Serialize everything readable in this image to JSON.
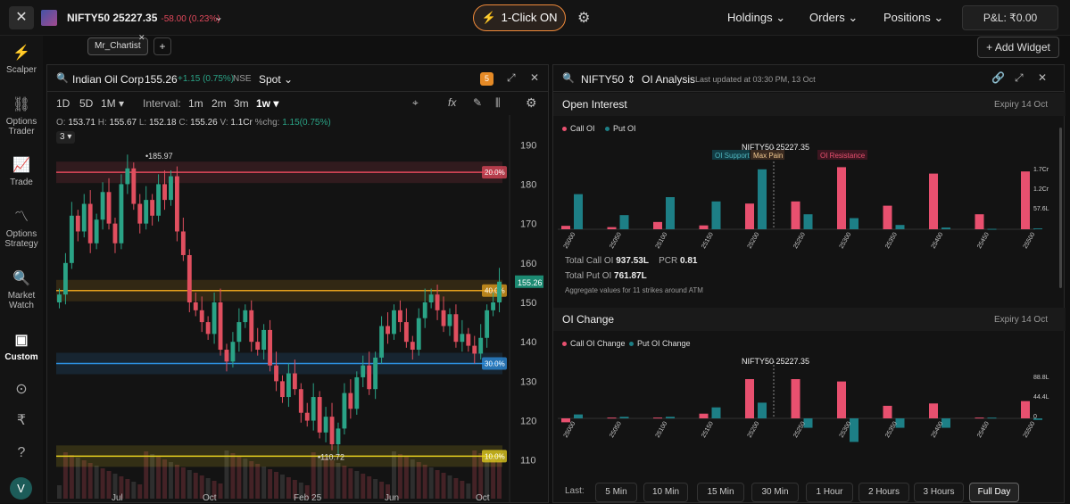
{
  "header": {
    "symbol": "NIFTY50 25227.35",
    "change": "-58.00 (0.23%)",
    "one_click": "1-Click ON",
    "nav": [
      "Holdings",
      "Orders",
      "Positions"
    ],
    "pnl": "P&L: ₹0.00"
  },
  "sidebar": {
    "items": [
      {
        "label": "Scalper",
        "icon": "lightning-icon"
      },
      {
        "label": "Options Trader",
        "icon": "link-icon"
      },
      {
        "label": "Trade",
        "icon": "chart-icon"
      },
      {
        "label": "Options Strategy",
        "icon": "strategy-icon"
      },
      {
        "label": "Market Watch",
        "icon": "watch-icon"
      },
      {
        "label": "Custom",
        "icon": "layout-icon"
      }
    ],
    "avatar": "V"
  },
  "tabs": {
    "active": "Mr_Chartist",
    "add_widget": "Add Widget"
  },
  "left_panel": {
    "instrument": "Indian Oil Corp",
    "price": "155.26",
    "change": "+1.15 (0.75%)",
    "exchange": "NSE",
    "segment": "Spot",
    "badge": "5",
    "ranges": [
      "1D",
      "5D",
      "1M"
    ],
    "interval_label": "Interval:",
    "intervals": [
      "1m",
      "2m",
      "3m",
      "1w"
    ],
    "ohlc": {
      "o": "153.71",
      "h": "155.67",
      "l": "152.18",
      "c": "155.26",
      "v": "1.1Cr",
      "chg_label": "%chg:",
      "chg": "1.15(0.75%)"
    },
    "indicator_count": "3"
  },
  "right_panel": {
    "symbol": "NIFTY50",
    "title": "OI Analysis",
    "updated": "Last updated at 03:30 PM, 13 Oct",
    "oi_section": "Open Interest",
    "oi_change_section": "OI Change",
    "expiry": "Expiry 14 Oct",
    "legend_call": "Call OI",
    "legend_put": "Put OI",
    "legend_call_change": "Call OI Change",
    "legend_put_change": "Put OI Change",
    "total_call_label": "Total Call OI",
    "total_call": "937.53L",
    "pcr_label": "PCR",
    "pcr": "0.81",
    "total_put_label": "Total Put OI",
    "total_put": "761.87L",
    "aggregate_note": "Aggregate values for 11 strikes around ATM",
    "last_label": "Last:",
    "time_buttons": [
      "5 Min",
      "10 Min",
      "15 Min",
      "30 Min",
      "1 Hour",
      "2 Hours",
      "3 Hours",
      "Full Day"
    ],
    "active_time": "Full Day"
  },
  "colors": {
    "call": "#e8506f",
    "put": "#1d7f86",
    "up": "#2aa386",
    "down": "#e04f5f",
    "accent": "#f08a3a"
  },
  "chart_data": [
    {
      "type": "candlestick",
      "title": "Indian Oil Corp",
      "x_ticks": [
        "Jul",
        "Oct",
        "Feb 25",
        "Jun",
        "Oct"
      ],
      "y_ticks": [
        110,
        120,
        130,
        140,
        150,
        160,
        170,
        180,
        190
      ],
      "ylim": [
        107,
        193
      ],
      "last_price": 155.26,
      "high_marker": 185.97,
      "low_marker": 110.72,
      "levels": [
        {
          "value": 183,
          "label": "20.0%",
          "color": "#e0485b"
        },
        {
          "value": 153,
          "label": "40.0%",
          "color": "#e6a21d"
        },
        {
          "value": 134.5,
          "label": "30.0%",
          "color": "#2d8fe0"
        },
        {
          "value": 111,
          "label": "10.0%",
          "color": "#e8d11f"
        }
      ],
      "closes": [
        152,
        160,
        172,
        168,
        175,
        165,
        171,
        178,
        170,
        165,
        180,
        184,
        175,
        170,
        176,
        172,
        180,
        176,
        182,
        168,
        162,
        150,
        148,
        145,
        142,
        150,
        138,
        135,
        140,
        145,
        148,
        140,
        138,
        143,
        134,
        130,
        126,
        132,
        128,
        122,
        120,
        126,
        117,
        121,
        114,
        118,
        127,
        123,
        131,
        134,
        128,
        136,
        144,
        142,
        148,
        145,
        140,
        138,
        146,
        150,
        152,
        148,
        144,
        147,
        140,
        142,
        139,
        137,
        141,
        148,
        150,
        155.26
      ]
    },
    {
      "type": "bar",
      "title": "Open Interest",
      "label_top": "NIFTY50 25227.35",
      "tags": [
        "OI Support",
        "Max Pain",
        "OI Resistance"
      ],
      "categories": [
        "25000",
        "25050",
        "25100",
        "25150",
        "25200",
        "25250",
        "25300",
        "25350",
        "25400",
        "25450",
        "25500"
      ],
      "y_ticks": [
        "57.6L",
        "1.2Cr",
        "1.7Cr"
      ],
      "series": [
        {
          "name": "Call OI",
          "values": [
            8,
            5,
            17,
            9,
            60,
            65,
            145,
            55,
            130,
            35,
            135
          ]
        },
        {
          "name": "Put OI",
          "values": [
            82,
            33,
            75,
            65,
            140,
            35,
            26,
            10,
            4,
            1,
            2
          ]
        }
      ]
    },
    {
      "type": "bar",
      "title": "OI Change",
      "label_top": "NIFTY50 25227.35",
      "categories": [
        "25000",
        "25050",
        "25100",
        "25150",
        "25200",
        "25250",
        "25300",
        "25350",
        "25400",
        "25450",
        "25500"
      ],
      "y_ticks": [
        "0",
        "44.4L",
        "88.8L"
      ],
      "series": [
        {
          "name": "Call OI Change",
          "values": [
            -5,
            1,
            1,
            6,
            50,
            50,
            47,
            16,
            19,
            1,
            22
          ]
        },
        {
          "name": "Put OI Change",
          "values": [
            5,
            2,
            2,
            14,
            20,
            -12,
            -30,
            -12,
            -12,
            1,
            -2
          ]
        }
      ]
    }
  ]
}
